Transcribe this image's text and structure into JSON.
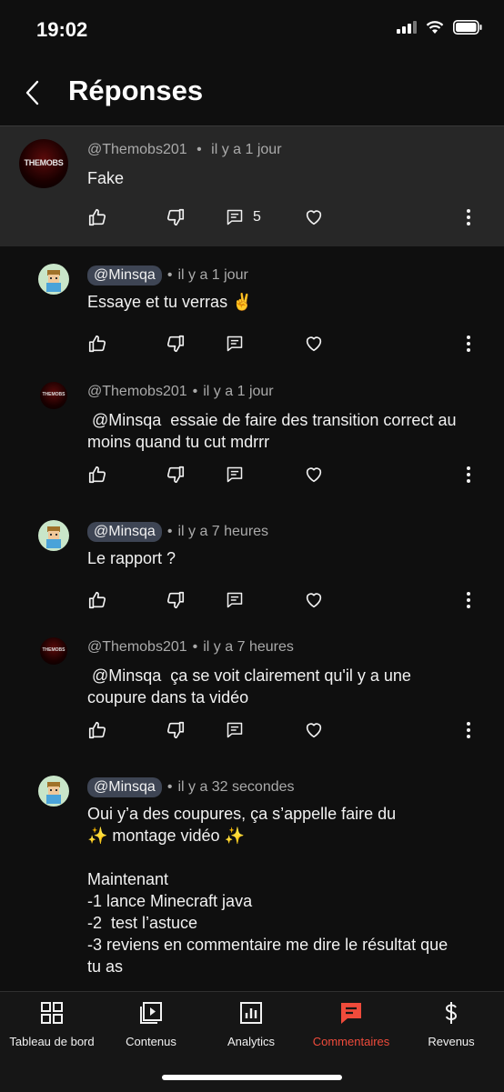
{
  "status": {
    "time": "19:02"
  },
  "header": {
    "title": "Réponses"
  },
  "parent": {
    "author": "@Themobs201",
    "sep": "•",
    "age": "il y a 1 jour",
    "text": "Fake",
    "reply_count": "5",
    "avatar_text": "THEMOBS"
  },
  "replies": [
    {
      "author": "@Minsqa",
      "age": "il y a 1 jour",
      "lines": [
        "Essaye et tu verras ✌️"
      ]
    },
    {
      "author": "@Themobs201",
      "age": "il y a 1 jour",
      "lines": [
        " @Minsqa  essaie de faire des transition correct au",
        "moins quand tu cut mdrrr"
      ],
      "avatar_text": "THEMOBS"
    },
    {
      "author": "@Minsqa",
      "age": "il y a 7 heures",
      "lines": [
        "Le rapport ?"
      ]
    },
    {
      "author": "@Themobs201",
      "age": "il y a 7 heures",
      "lines": [
        " @Minsqa  ça se voit clairement qu'il y a une",
        "coupure dans ta vidéo"
      ],
      "avatar_text": "THEMOBS"
    },
    {
      "author": "@Minsqa",
      "age": "il y a 32 secondes",
      "lines": [
        "Oui y’a des coupures, ça s’appelle faire du",
        "✨ montage vidéo ✨",
        "",
        "Maintenant",
        "-1 lance Minecraft java",
        "-2  test l’astuce",
        "-3 reviens en commentaire me dire le résultat que",
        "tu as"
      ]
    }
  ],
  "tabs": [
    {
      "label": "Tableau de bord",
      "icon": "dashboard-icon"
    },
    {
      "label": "Contenus",
      "icon": "content-icon"
    },
    {
      "label": "Analytics",
      "icon": "analytics-icon"
    },
    {
      "label": "Commentaires",
      "icon": "comments-icon",
      "active": true
    },
    {
      "label": "Revenus",
      "icon": "dollar-icon"
    }
  ],
  "colors": {
    "background": "#0f0f0f",
    "highlight": "#272727",
    "accent": "#ef4b3b",
    "chip": "#3e4554",
    "secondary_text": "#aaaaaa"
  }
}
